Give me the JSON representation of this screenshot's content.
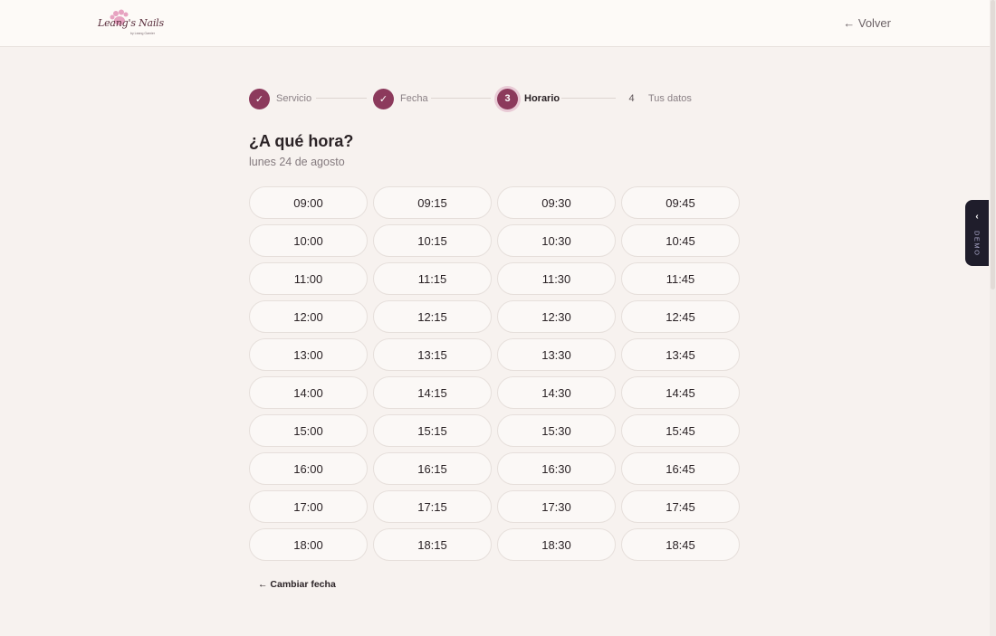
{
  "header": {
    "logo_text": "Leang's Nails",
    "logo_subtext": "by Leang Garnier",
    "back_label": "← Volver"
  },
  "stepper": {
    "steps": [
      {
        "marker": "✓",
        "label": "Servicio",
        "state": "done"
      },
      {
        "marker": "✓",
        "label": "Fecha",
        "state": "done"
      },
      {
        "marker": "3",
        "label": "Horario",
        "state": "current"
      },
      {
        "marker": "4",
        "label": "Tus datos",
        "state": "pending"
      }
    ]
  },
  "main": {
    "title": "¿A qué hora?",
    "date_label": "lunes 24 de agosto",
    "slots": [
      "09:00",
      "09:15",
      "09:30",
      "09:45",
      "10:00",
      "10:15",
      "10:30",
      "10:45",
      "11:00",
      "11:15",
      "11:30",
      "11:45",
      "12:00",
      "12:15",
      "12:30",
      "12:45",
      "13:00",
      "13:15",
      "13:30",
      "13:45",
      "14:00",
      "14:15",
      "14:30",
      "14:45",
      "15:00",
      "15:15",
      "15:30",
      "15:45",
      "16:00",
      "16:15",
      "16:30",
      "16:45",
      "17:00",
      "17:15",
      "17:30",
      "17:45",
      "18:00",
      "18:15",
      "18:30",
      "18:45"
    ],
    "change_date_label": "← Cambiar fecha"
  },
  "demo_tab": {
    "chevron": "‹",
    "label": "DEMO"
  },
  "colors": {
    "accent": "#8c3a5c",
    "background": "#f7f2ef",
    "demo_tab": "#1f1d2b"
  }
}
